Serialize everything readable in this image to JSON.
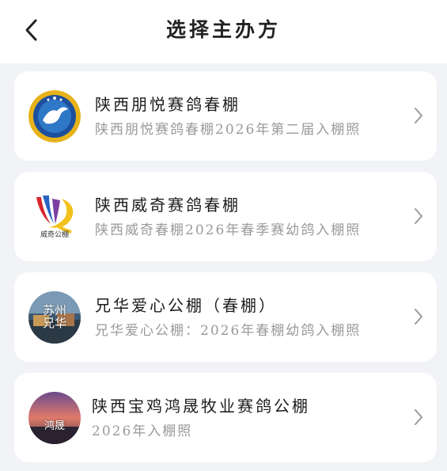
{
  "header": {
    "title": "选择主办方",
    "back_icon": "chevron-left-icon"
  },
  "organizers": [
    {
      "name": "陕西朋悦赛鸽春棚",
      "description": "陕西朋悦赛鸽春棚2026年第二届入棚照",
      "logo_icon": "pigeon-emblem-logo"
    },
    {
      "name": "陕西威奇赛鸽春棚",
      "description": "陕西威奇春棚2026年春季赛幼鸽入棚照",
      "logo_icon": "colorful-wing-logo",
      "logo_caption": "威奇公棚"
    },
    {
      "name": "兄华爱心公棚（春棚）",
      "description": "兄华爱心公棚：2026年春棚幼鸽入棚照",
      "logo_icon": "photo-logo",
      "logo_caption": "苏州兄华"
    },
    {
      "name": "陕西宝鸡鸿晟牧业赛鸽公棚",
      "description": "2026年入棚照",
      "logo_icon": "sunset-photo-logo",
      "logo_caption": "鸿晟"
    }
  ],
  "colors": {
    "background": "#f2f3f6",
    "card": "#ffffff",
    "primary_text": "#1c1c1c",
    "secondary_text": "#9a9a9a"
  }
}
